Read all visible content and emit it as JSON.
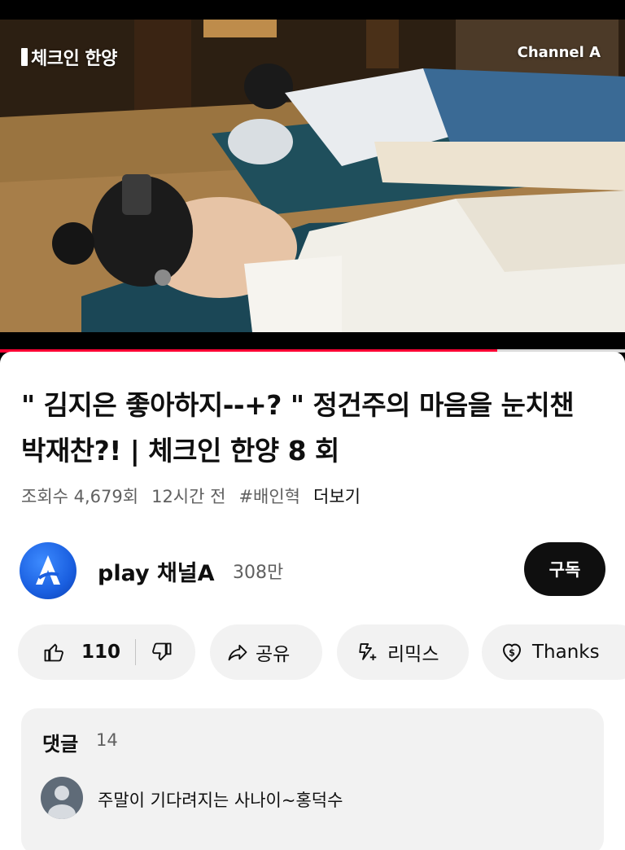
{
  "video": {
    "show_logo": "체크인 한양",
    "channel_logo": "Channel A",
    "progress_fraction": 0.795
  },
  "title": "\" 김지은 좋아하지--+? \"  정건주의 마음을 눈치챈 박재찬?! | 체크인 한양 8 회",
  "meta": {
    "views": "조회수 4,679회",
    "age": "12시간 전",
    "hashtag": "#배인혁",
    "more": "더보기"
  },
  "channel": {
    "name": "play 채널A",
    "subscribers": "308만",
    "subscribe_label": "구독",
    "avatar_icon": "channel-a-logo-icon",
    "avatar_color": "#1a5fe0"
  },
  "actions": {
    "like_count": "110",
    "share_label": "공유",
    "remix_label": "리믹스",
    "thanks_label": "Thanks"
  },
  "comments": {
    "heading": "댓글",
    "count": "14",
    "top_comment": "주말이 기다려지는 사나이~홍덕수"
  },
  "colors": {
    "progress": "#ff0033",
    "pill_bg": "#f2f2f2",
    "subscribe_bg": "#0f0f0f"
  }
}
